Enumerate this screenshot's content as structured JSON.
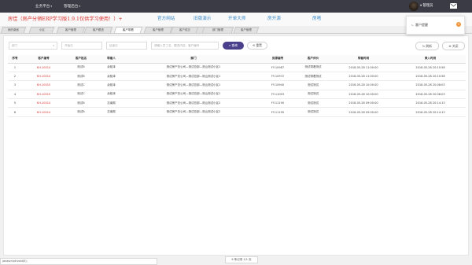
{
  "topbar": {
    "menu1": "业务平台",
    "menu2": "管理后台",
    "caret": "▾",
    "user": "▾ 管理员"
  },
  "promo": {
    "headline": "房佳（房产分销ERP学习版1.9.1仅供学习使用！）+",
    "links": [
      "官方网站",
      "旧版演示",
      "开单大师",
      "房开源",
      "房嗒"
    ]
  },
  "tabs": [
    "我的桌面",
    "小区",
    "客户管理",
    "客户跟进",
    "客户带看",
    "客户管理",
    "客户成交",
    "客户日志",
    "部门管理",
    "客户管理"
  ],
  "filters": {
    "dept_placeholder": "部门",
    "start_placeholder": "开始日",
    "end_placeholder": "结束日",
    "keyword_placeholder": "请输入员工名、跟进内容、客户编号",
    "search": "⌕ 查询",
    "reset": "⟲ 重置",
    "refresh": "↻ 刷新",
    "close": "⊗ 关闭"
  },
  "table": {
    "headers": [
      "序号",
      "客户编号",
      "客户姓名",
      "带看人",
      "部门",
      "房源编号",
      "客户评价",
      "带看时间",
      "录入时间"
    ],
    "rows": [
      [
        "1",
        "KH-10014",
        "测试B",
        "余航泽",
        "测试房产总公司—测试总部—测山测试小区1",
        "FY-10987",
        "测试带看测试",
        "2018-05-28 11:00:00",
        "2018-05-28 20:10:58"
      ],
      [
        "2",
        "KH-10014",
        "测试B",
        "余航泽",
        "测试房产总公司—测试总部—测山测试小区1",
        "FY-10972",
        "测试带看测试",
        "2018-05-28 11:00:00",
        "2018-05-28 20:10:58"
      ],
      [
        "3",
        "KH-10015",
        "测试C",
        "余航泽",
        "测试房产总公司—测试总部—测山测试小区1",
        "FY-10940",
        "测试测试",
        "2018-05-28 10:00:00",
        "2018-05-28 20:08:03"
      ],
      [
        "4",
        "KH-10015",
        "测试C",
        "余航泽",
        "测试房产总公司—测试总部—测山测试小区1",
        "FY-11003",
        "测试测试",
        "2018-05-28 10:00:00",
        "2018-05-28 20:08:03"
      ],
      [
        "5",
        "KH-10014",
        "测试B",
        "志南熙",
        "测试房产总公司—测试总部—测山测试小区2",
        "FY-11190",
        "测试测试",
        "2018-05-28 09:00:00",
        "2018-05-28 20:14:13"
      ],
      [
        "6",
        "KH-10014",
        "测试B",
        "志南熙",
        "测试房产总公司—测试总部—测山测试小区2",
        "FY-11195",
        "测试测试",
        "2018-05-28 09:00:00",
        "2018-05-28 20:14:13"
      ]
    ]
  },
  "footer": {
    "status": "javascript:void(0);",
    "pager": "6 条记录 1/1 页"
  },
  "dropdown": {
    "item": "客户提醒",
    "icon": "⤷",
    "badge": "5"
  },
  "colors": {
    "topbar": "#3a3b45",
    "accent": "#4a3f8a",
    "code_red": "#d9302c",
    "link_blue": "#3b88c7",
    "badge_orange": "#f0953a"
  }
}
